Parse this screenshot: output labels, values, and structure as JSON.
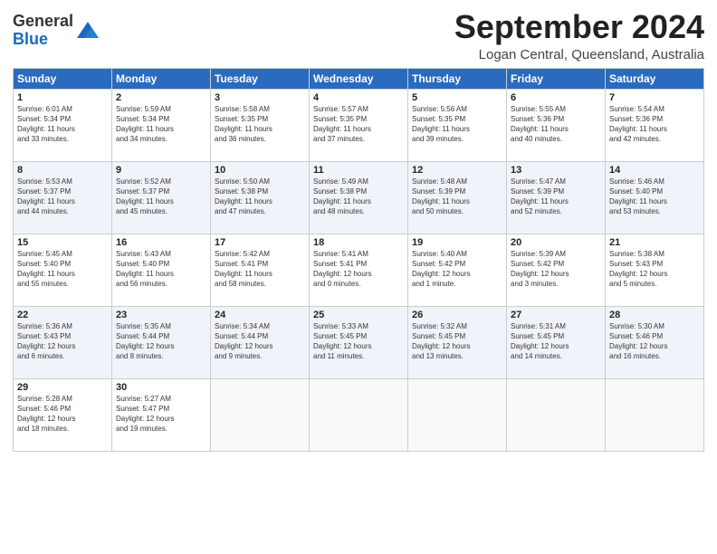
{
  "header": {
    "logo_line1": "General",
    "logo_line2": "Blue",
    "month": "September 2024",
    "location": "Logan Central, Queensland, Australia"
  },
  "weekdays": [
    "Sunday",
    "Monday",
    "Tuesday",
    "Wednesday",
    "Thursday",
    "Friday",
    "Saturday"
  ],
  "weeks": [
    [
      {
        "day": "1",
        "info": "Sunrise: 6:01 AM\nSunset: 5:34 PM\nDaylight: 11 hours\nand 33 minutes."
      },
      {
        "day": "2",
        "info": "Sunrise: 5:59 AM\nSunset: 5:34 PM\nDaylight: 11 hours\nand 34 minutes."
      },
      {
        "day": "3",
        "info": "Sunrise: 5:58 AM\nSunset: 5:35 PM\nDaylight: 11 hours\nand 36 minutes."
      },
      {
        "day": "4",
        "info": "Sunrise: 5:57 AM\nSunset: 5:35 PM\nDaylight: 11 hours\nand 37 minutes."
      },
      {
        "day": "5",
        "info": "Sunrise: 5:56 AM\nSunset: 5:35 PM\nDaylight: 11 hours\nand 39 minutes."
      },
      {
        "day": "6",
        "info": "Sunrise: 5:55 AM\nSunset: 5:36 PM\nDaylight: 11 hours\nand 40 minutes."
      },
      {
        "day": "7",
        "info": "Sunrise: 5:54 AM\nSunset: 5:36 PM\nDaylight: 11 hours\nand 42 minutes."
      }
    ],
    [
      {
        "day": "8",
        "info": "Sunrise: 5:53 AM\nSunset: 5:37 PM\nDaylight: 11 hours\nand 44 minutes."
      },
      {
        "day": "9",
        "info": "Sunrise: 5:52 AM\nSunset: 5:37 PM\nDaylight: 11 hours\nand 45 minutes."
      },
      {
        "day": "10",
        "info": "Sunrise: 5:50 AM\nSunset: 5:38 PM\nDaylight: 11 hours\nand 47 minutes."
      },
      {
        "day": "11",
        "info": "Sunrise: 5:49 AM\nSunset: 5:38 PM\nDaylight: 11 hours\nand 48 minutes."
      },
      {
        "day": "12",
        "info": "Sunrise: 5:48 AM\nSunset: 5:39 PM\nDaylight: 11 hours\nand 50 minutes."
      },
      {
        "day": "13",
        "info": "Sunrise: 5:47 AM\nSunset: 5:39 PM\nDaylight: 11 hours\nand 52 minutes."
      },
      {
        "day": "14",
        "info": "Sunrise: 5:46 AM\nSunset: 5:40 PM\nDaylight: 11 hours\nand 53 minutes."
      }
    ],
    [
      {
        "day": "15",
        "info": "Sunrise: 5:45 AM\nSunset: 5:40 PM\nDaylight: 11 hours\nand 55 minutes."
      },
      {
        "day": "16",
        "info": "Sunrise: 5:43 AM\nSunset: 5:40 PM\nDaylight: 11 hours\nand 56 minutes."
      },
      {
        "day": "17",
        "info": "Sunrise: 5:42 AM\nSunset: 5:41 PM\nDaylight: 11 hours\nand 58 minutes."
      },
      {
        "day": "18",
        "info": "Sunrise: 5:41 AM\nSunset: 5:41 PM\nDaylight: 12 hours\nand 0 minutes."
      },
      {
        "day": "19",
        "info": "Sunrise: 5:40 AM\nSunset: 5:42 PM\nDaylight: 12 hours\nand 1 minute."
      },
      {
        "day": "20",
        "info": "Sunrise: 5:39 AM\nSunset: 5:42 PM\nDaylight: 12 hours\nand 3 minutes."
      },
      {
        "day": "21",
        "info": "Sunrise: 5:38 AM\nSunset: 5:43 PM\nDaylight: 12 hours\nand 5 minutes."
      }
    ],
    [
      {
        "day": "22",
        "info": "Sunrise: 5:36 AM\nSunset: 5:43 PM\nDaylight: 12 hours\nand 6 minutes."
      },
      {
        "day": "23",
        "info": "Sunrise: 5:35 AM\nSunset: 5:44 PM\nDaylight: 12 hours\nand 8 minutes."
      },
      {
        "day": "24",
        "info": "Sunrise: 5:34 AM\nSunset: 5:44 PM\nDaylight: 12 hours\nand 9 minutes."
      },
      {
        "day": "25",
        "info": "Sunrise: 5:33 AM\nSunset: 5:45 PM\nDaylight: 12 hours\nand 11 minutes."
      },
      {
        "day": "26",
        "info": "Sunrise: 5:32 AM\nSunset: 5:45 PM\nDaylight: 12 hours\nand 13 minutes."
      },
      {
        "day": "27",
        "info": "Sunrise: 5:31 AM\nSunset: 5:45 PM\nDaylight: 12 hours\nand 14 minutes."
      },
      {
        "day": "28",
        "info": "Sunrise: 5:30 AM\nSunset: 5:46 PM\nDaylight: 12 hours\nand 16 minutes."
      }
    ],
    [
      {
        "day": "29",
        "info": "Sunrise: 5:28 AM\nSunset: 5:46 PM\nDaylight: 12 hours\nand 18 minutes."
      },
      {
        "day": "30",
        "info": "Sunrise: 5:27 AM\nSunset: 5:47 PM\nDaylight: 12 hours\nand 19 minutes."
      },
      {
        "day": "",
        "info": ""
      },
      {
        "day": "",
        "info": ""
      },
      {
        "day": "",
        "info": ""
      },
      {
        "day": "",
        "info": ""
      },
      {
        "day": "",
        "info": ""
      }
    ]
  ]
}
